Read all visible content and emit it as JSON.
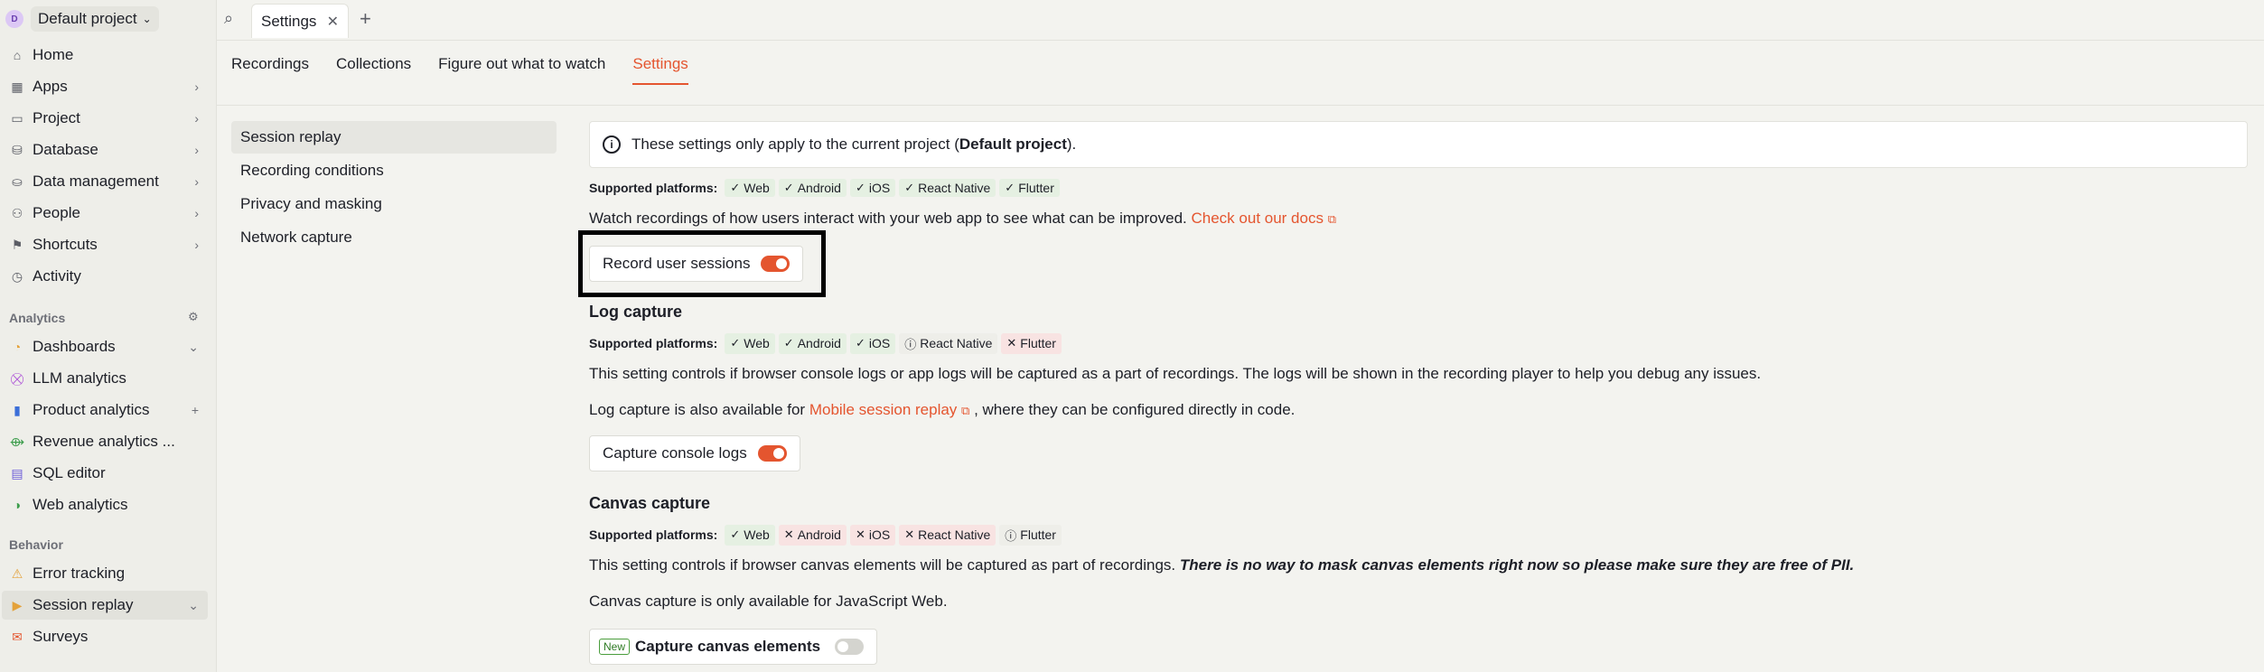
{
  "project": {
    "avatar": "D",
    "name": "Default project"
  },
  "sidebar": {
    "items": [
      {
        "label": "Home",
        "icon": "home-icon"
      },
      {
        "label": "Apps",
        "icon": "apps-icon"
      },
      {
        "label": "Project",
        "icon": "folder-icon"
      },
      {
        "label": "Database",
        "icon": "database-icon"
      },
      {
        "label": "Data management",
        "icon": "data-icon"
      },
      {
        "label": "People",
        "icon": "people-icon"
      },
      {
        "label": "Shortcuts",
        "icon": "shortcut-icon"
      },
      {
        "label": "Activity",
        "icon": "clock-icon"
      }
    ],
    "analytics_label": "Analytics",
    "analytics": [
      {
        "label": "Dashboards"
      },
      {
        "label": "LLM analytics"
      },
      {
        "label": "Product analytics"
      },
      {
        "label": "Revenue analytics ..."
      },
      {
        "label": "SQL editor"
      },
      {
        "label": "Web analytics"
      }
    ],
    "behavior_label": "Behavior",
    "behavior": [
      {
        "label": "Error tracking"
      },
      {
        "label": "Session replay"
      },
      {
        "label": "Surveys"
      }
    ]
  },
  "tabbar": {
    "tab_label": "Settings"
  },
  "subtabs": [
    "Recordings",
    "Collections",
    "Figure out what to watch",
    "Settings"
  ],
  "subnav": [
    "Session replay",
    "Recording conditions",
    "Privacy and masking",
    "Network capture"
  ],
  "info": {
    "text_pre": "These settings only apply to the current project (",
    "project": "Default project",
    "text_post": ")."
  },
  "platforms_label": "Supported platforms:",
  "session": {
    "platforms": [
      {
        "name": "Web",
        "mark": "✓",
        "kind": "yes"
      },
      {
        "name": "Android",
        "mark": "✓",
        "kind": "yes"
      },
      {
        "name": "iOS",
        "mark": "✓",
        "kind": "yes"
      },
      {
        "name": "React Native",
        "mark": "✓",
        "kind": "yes"
      },
      {
        "name": "Flutter",
        "mark": "✓",
        "kind": "yes"
      }
    ],
    "desc": "Watch recordings of how users interact with your web app to see what can be improved.",
    "link": "Check out our docs",
    "toggle": "Record user sessions"
  },
  "log": {
    "title": "Log capture",
    "platforms": [
      {
        "name": "Web",
        "mark": "✓",
        "kind": "yes"
      },
      {
        "name": "Android",
        "mark": "✓",
        "kind": "yes"
      },
      {
        "name": "iOS",
        "mark": "✓",
        "kind": "yes"
      },
      {
        "name": "React Native",
        "mark": "ⓘ",
        "kind": "partial"
      },
      {
        "name": "Flutter",
        "mark": "✕",
        "kind": "no"
      }
    ],
    "desc": "This setting controls if browser console logs or app logs will be captured as a part of recordings. The logs will be shown in the recording player to help you debug any issues.",
    "also_pre": "Log capture is also available for",
    "also_link": "Mobile session replay",
    "also_post": ", where they can be configured directly in code.",
    "toggle": "Capture console logs"
  },
  "canvas": {
    "title": "Canvas capture",
    "platforms": [
      {
        "name": "Web",
        "mark": "✓",
        "kind": "yes"
      },
      {
        "name": "Android",
        "mark": "✕",
        "kind": "no"
      },
      {
        "name": "iOS",
        "mark": "✕",
        "kind": "no"
      },
      {
        "name": "React Native",
        "mark": "✕",
        "kind": "no"
      },
      {
        "name": "Flutter",
        "mark": "ⓘ",
        "kind": "partial"
      }
    ],
    "desc": "This setting controls if browser canvas elements will be captured as part of recordings.",
    "warning": "There is no way to mask canvas elements right now so please make sure they are free of PII.",
    "only": "Canvas capture is only available for JavaScript Web.",
    "new_badge": "New",
    "toggle": "Capture canvas elements"
  }
}
